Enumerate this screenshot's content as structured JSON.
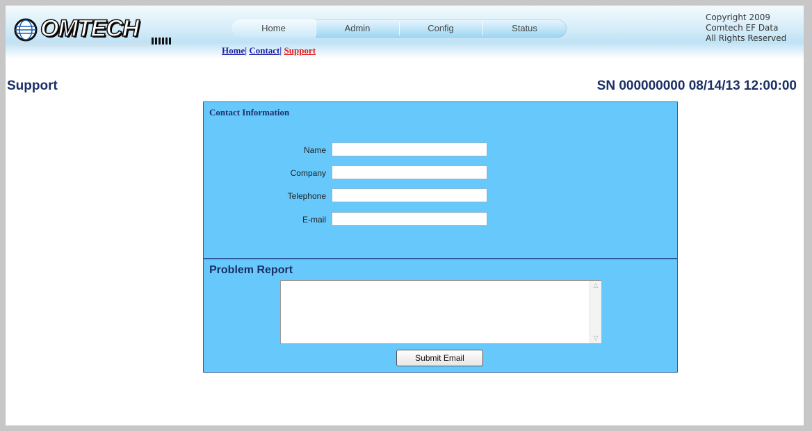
{
  "header": {
    "logo_text": "OMTECH",
    "copyright_line1": "Copyright 2009",
    "copyright_line2": "Comtech EF Data",
    "copyright_line3": "All Rights Reserved"
  },
  "nav": {
    "tabs": [
      {
        "label": "Home"
      },
      {
        "label": "Admin"
      },
      {
        "label": "Config"
      },
      {
        "label": "Status"
      }
    ]
  },
  "sublinks": {
    "home": "Home",
    "contact": "Contact",
    "support": "Support",
    "separator": "|"
  },
  "page": {
    "title": "Support",
    "sn_line": "SN 000000000 08/14/13 12:00:00"
  },
  "contact": {
    "title": "Contact Information",
    "fields": [
      {
        "label": "Name",
        "value": ""
      },
      {
        "label": "Company",
        "value": ""
      },
      {
        "label": "Telephone",
        "value": ""
      },
      {
        "label": "E-mail",
        "value": ""
      }
    ]
  },
  "report": {
    "title": "Problem Report",
    "value": ""
  },
  "buttons": {
    "submit_label": "Submit Email"
  },
  "colors": {
    "panel_bg": "#66c8fb",
    "title_text": "#1a2f66",
    "active_link": "#e21b1b",
    "link": "#1b1ea8"
  }
}
